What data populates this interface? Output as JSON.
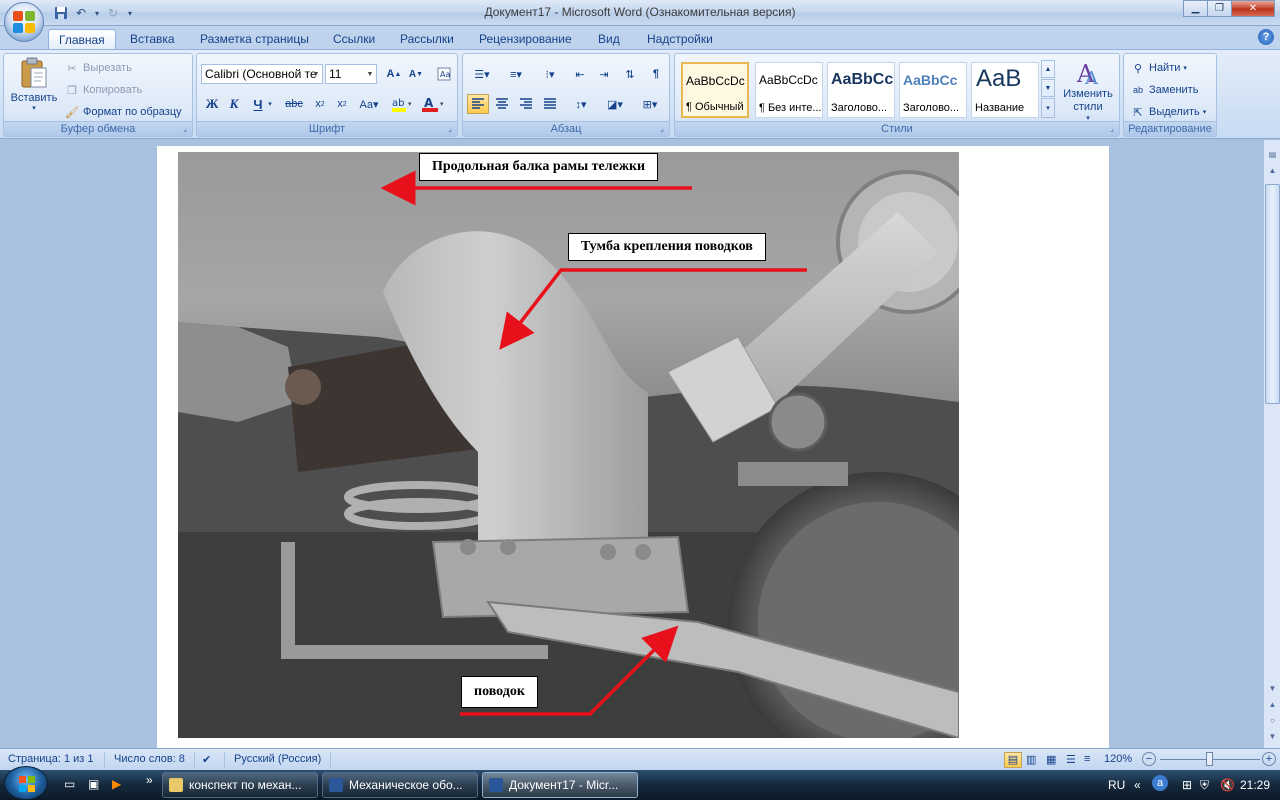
{
  "window": {
    "title": "Документ17 - Microsoft Word (Ознакомительная версия)"
  },
  "tabs": [
    "Главная",
    "Вставка",
    "Разметка страницы",
    "Ссылки",
    "Рассылки",
    "Рецензирование",
    "Вид",
    "Надстройки"
  ],
  "ribbon": {
    "clipboard": {
      "label": "Буфер обмена",
      "paste": "Вставить",
      "cut": "Вырезать",
      "copy": "Копировать",
      "format_painter": "Формат по образцу"
    },
    "font": {
      "label": "Шрифт",
      "font_name": "Calibri (Основной те",
      "font_size": "11"
    },
    "paragraph": {
      "label": "Абзац"
    },
    "styles": {
      "label": "Стили",
      "items": [
        {
          "sample": "AaBbCcDc",
          "name": "¶ Обычный"
        },
        {
          "sample": "AaBbCcDc",
          "name": "¶ Без инте..."
        },
        {
          "sample": "AaBbCc",
          "name": "Заголово..."
        },
        {
          "sample": "AaBbCc",
          "name": "Заголово..."
        },
        {
          "sample": "AaB",
          "name": "Название"
        }
      ],
      "change_styles": "Изменить стили"
    },
    "editing": {
      "label": "Редактирование",
      "find": "Найти",
      "replace": "Заменить",
      "select": "Выделить"
    }
  },
  "document": {
    "callouts": {
      "beam": "Продольная балка рамы тележки",
      "pedestal": "Тумба крепления поводков",
      "link": "поводок"
    }
  },
  "statusbar": {
    "page": "Страница: 1 из 1",
    "words": "Число слов: 8",
    "language": "Русский (Россия)",
    "zoom": "120%"
  },
  "taskbar": {
    "tasks": [
      "конспект по механ...",
      "Механическое обо...",
      "Документ17 - Micr..."
    ],
    "language": "RU",
    "clock": "21:29"
  }
}
